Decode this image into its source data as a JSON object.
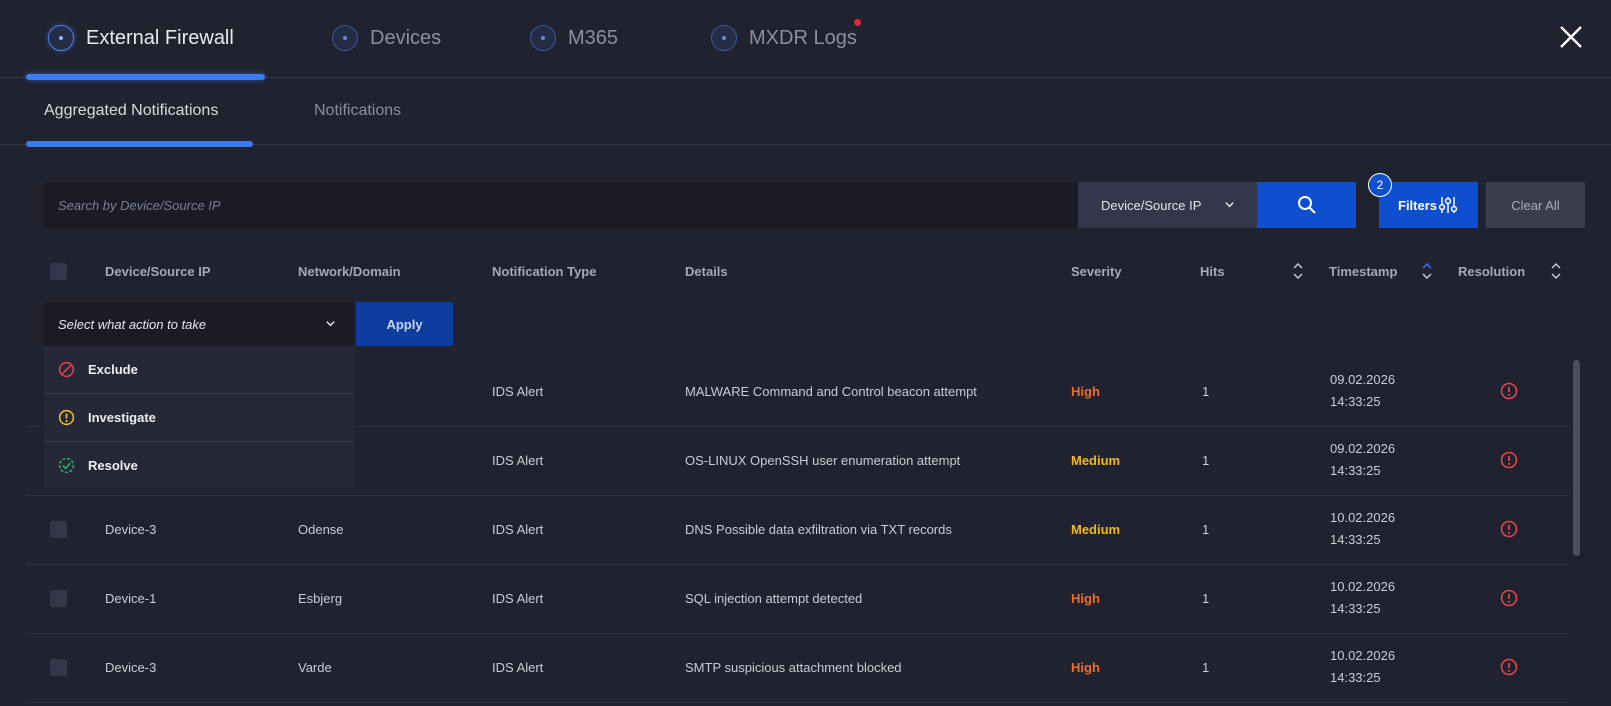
{
  "main_tabs": [
    {
      "label": "External Firewall",
      "active": true
    },
    {
      "label": "Devices",
      "active": false
    },
    {
      "label": "M365",
      "active": false
    },
    {
      "label": "MXDR Logs",
      "active": false,
      "has_notification": true
    }
  ],
  "sub_tabs": [
    {
      "label": "Aggregated Notifications",
      "active": true
    },
    {
      "label": "Notifications",
      "active": false
    }
  ],
  "search": {
    "placeholder": "Search by Device/Source IP",
    "field_select": "Device/Source IP"
  },
  "filters": {
    "label": "Filters",
    "count": "2"
  },
  "clear_all": "Clear All",
  "table": {
    "headers": {
      "device": "Device/Source IP",
      "network": "Network/Domain",
      "type": "Notification Type",
      "details": "Details",
      "severity": "Severity",
      "hits": "Hits",
      "timestamp": "Timestamp",
      "resolution": "Resolution"
    },
    "rows": [
      {
        "device": "",
        "network": "",
        "type": "IDS Alert",
        "details": "MALWARE Command and Control beacon attempt",
        "severity": "High",
        "hits": "1",
        "date": "09.02.2026",
        "time": "14:33:25"
      },
      {
        "device": "",
        "network": "",
        "type": "IDS Alert",
        "details": "OS-LINUX OpenSSH user enumeration attempt",
        "severity": "Medium",
        "hits": "1",
        "date": "09.02.2026",
        "time": "14:33:25"
      },
      {
        "device": "Device-3",
        "network": "Odense",
        "type": "IDS Alert",
        "details": "DNS Possible data exfiltration via TXT records",
        "severity": "Medium",
        "hits": "1",
        "date": "10.02.2026",
        "time": "14:33:25"
      },
      {
        "device": "Device-1",
        "network": "Esbjerg",
        "type": "IDS Alert",
        "details": "SQL injection attempt detected",
        "severity": "High",
        "hits": "1",
        "date": "10.02.2026",
        "time": "14:33:25"
      },
      {
        "device": "Device-3",
        "network": "Varde",
        "type": "IDS Alert",
        "details": "SMTP suspicious attachment blocked",
        "severity": "High",
        "hits": "1",
        "date": "10.02.2026",
        "time": "14:33:25"
      }
    ]
  },
  "bulk_action": {
    "placeholder": "Select what action to take",
    "apply_label": "Apply",
    "options": [
      "Exclude",
      "Investigate",
      "Resolve"
    ]
  },
  "colors": {
    "accent": "#0e4fcf",
    "severity_high": "#f26d21",
    "severity_medium": "#f2b81c",
    "resolution_icon": "#e0474c"
  }
}
